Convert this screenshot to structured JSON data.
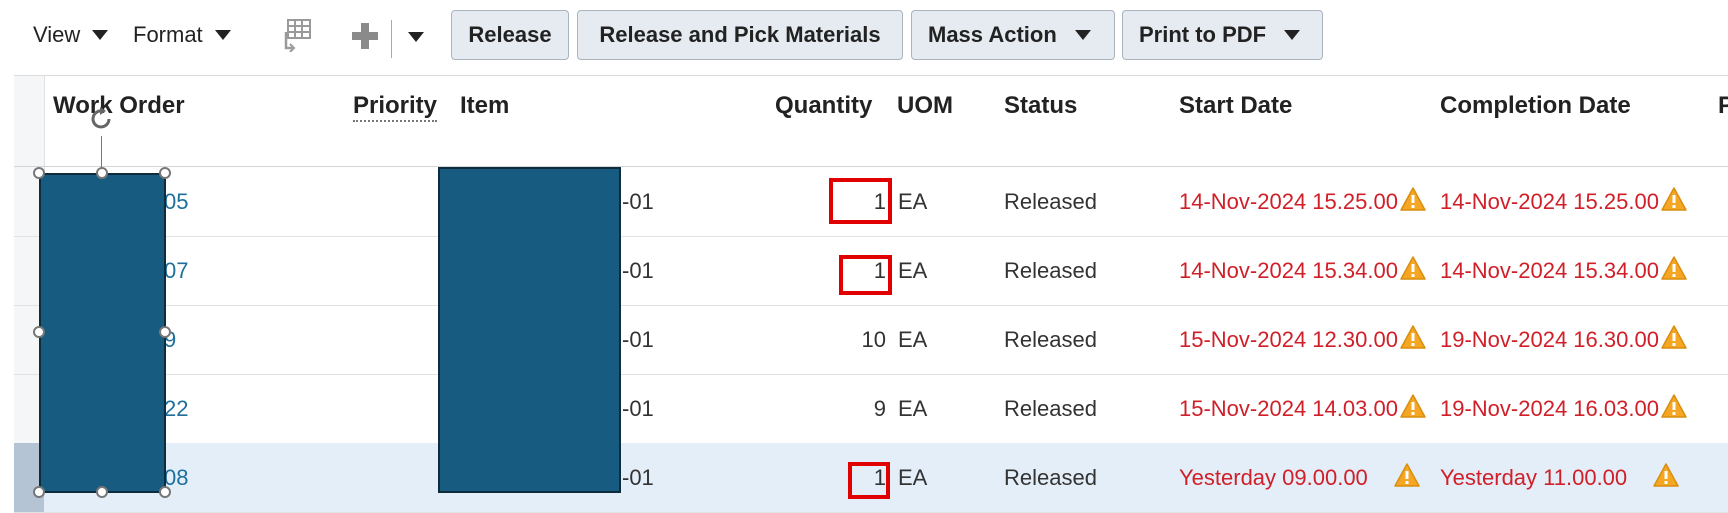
{
  "toolbar": {
    "view_label": "View",
    "format_label": "Format",
    "release_label": "Release",
    "release_pick_label": "Release and Pick Materials",
    "mass_action_label": "Mass Action",
    "print_pdf_label": "Print to PDF",
    "icons": [
      "freeze-columns-icon",
      "add-icon",
      "chevron-down-icon"
    ]
  },
  "table": {
    "columns": [
      "Work Order",
      "Priority",
      "Item",
      "Quantity",
      "UOM",
      "Status",
      "Start Date",
      "Completion Date",
      "P"
    ],
    "rows": [
      {
        "wo": "05",
        "item": "-01",
        "qty": "1",
        "uom": "EA",
        "status": "Released",
        "start": "14-Nov-2024 15.25.00",
        "completion": "14-Nov-2024 15.25.00"
      },
      {
        "wo": "07",
        "item": "-01",
        "qty": "1",
        "uom": "EA",
        "status": "Released",
        "start": "14-Nov-2024 15.34.00",
        "completion": "14-Nov-2024 15.34.00"
      },
      {
        "wo": "9",
        "item": "-01",
        "qty": "10",
        "uom": "EA",
        "status": "Released",
        "start": "15-Nov-2024 12.30.00",
        "completion": "19-Nov-2024 16.30.00"
      },
      {
        "wo": "22",
        "item": "-01",
        "qty": "9",
        "uom": "EA",
        "status": "Released",
        "start": "15-Nov-2024 14.03.00",
        "completion": "19-Nov-2024 16.03.00"
      },
      {
        "wo": "08",
        "item": "-01",
        "qty": "1",
        "uom": "EA",
        "status": "Released",
        "start": "Yesterday 09.00.00",
        "completion": "Yesterday 11.00.00"
      }
    ],
    "selected_row": 4,
    "warning_icon": "warning-icon",
    "colors": {
      "link": "#1e6f9c",
      "late_date": "#d01f28",
      "highlight": "#e00000",
      "redaction": "#175c80"
    }
  }
}
